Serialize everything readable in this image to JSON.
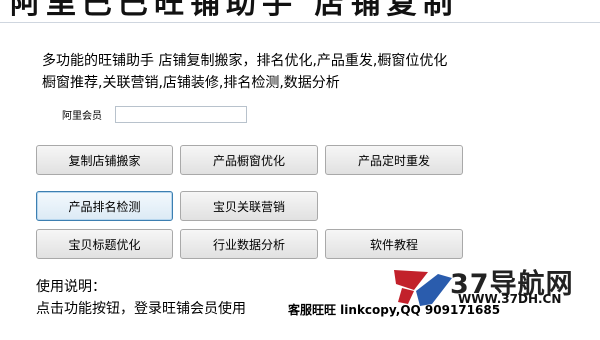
{
  "header": {
    "title": "阿里巴巴旺铺助手 店铺复制"
  },
  "intro": {
    "line1": "多功能的旺铺助手 店铺复制搬家，排名优化,产品重发,橱窗位优化",
    "line2": "橱窗推荐,关联营销,店铺装修,排名检测,数据分析"
  },
  "member": {
    "label": "阿里会员",
    "value": "",
    "placeholder": ""
  },
  "buttons": {
    "copy_shop": "复制店铺搬家",
    "window_opt": "产品橱窗优化",
    "scheduled_repost": "产品定时重发",
    "rank_check": "产品排名检测",
    "related_marketing": "宝贝关联营销",
    "title_opt": "宝贝标题优化",
    "industry_data": "行业数据分析",
    "tutorial": "软件教程"
  },
  "usage": {
    "title": "使用说明：",
    "text": "点击功能按钮，登录旺铺会员使用"
  },
  "service": {
    "text": "客服旺旺 linkcopy,QQ 909171685"
  },
  "watermark": {
    "title": "37导航网",
    "url": "WWW.37DH.CN",
    "logo_colors": [
      "#c2212b",
      "#2a5cad"
    ]
  },
  "icons": {
    "logo": "37dh-logo-icon"
  }
}
